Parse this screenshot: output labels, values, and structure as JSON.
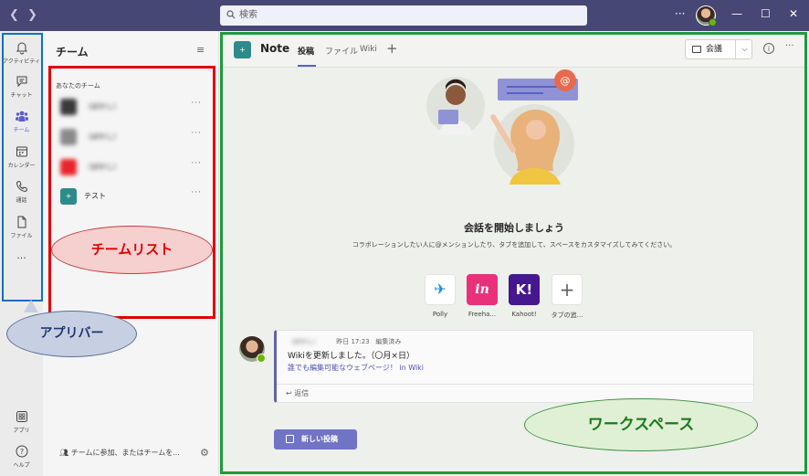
{
  "titlebar": {
    "search_placeholder": "検索",
    "more": "···",
    "minimize": "—",
    "maximize": "☐",
    "close": "✕"
  },
  "appbar": {
    "items": [
      {
        "label": "アクティビティ",
        "icon": "bell-icon"
      },
      {
        "label": "チャット",
        "icon": "chat-icon"
      },
      {
        "label": "チーム",
        "icon": "teams-icon",
        "active": true
      },
      {
        "label": "カレンダー",
        "icon": "calendar-icon"
      },
      {
        "label": "通話",
        "icon": "phone-icon"
      },
      {
        "label": "ファイル",
        "icon": "file-icon"
      }
    ],
    "more": "···",
    "bottom_items": [
      {
        "label": "アプリ",
        "icon": "apps-icon"
      },
      {
        "label": "ヘルプ",
        "icon": "help-icon"
      }
    ]
  },
  "team_pane": {
    "title": "チーム",
    "section_label": "あなたのチーム",
    "teams": [
      {
        "name": "（ぼかし）",
        "blurred": true,
        "logo_color": "#3a3a3a"
      },
      {
        "name": "（ぼかし）",
        "blurred": true,
        "logo_color": "#8a8a8a"
      },
      {
        "name": "（ぼかし）",
        "blurred": true,
        "logo_color": "#e8242c"
      },
      {
        "name": "テスト",
        "blurred": false,
        "logo_color": "#2e8b8b"
      }
    ],
    "more": "···",
    "join_label": "チームに参加、またはチームを..."
  },
  "callouts": {
    "team_list": "チームリスト",
    "app_bar": "アプリバー",
    "workspace": "ワークスペース"
  },
  "workspace": {
    "channel_name": "Note",
    "tabs": [
      "投稿",
      "ファイル",
      "Wiki"
    ],
    "tab_add": "+",
    "meet_label": "会議",
    "meet_caret": "⌵",
    "info": "i",
    "more": "···",
    "start_title": "会話を開始しましょう",
    "start_desc": "コラボレーションしたい人に@メンションしたり、タブを追加して、スペースをカスタマイズしてみてください。",
    "apps": [
      {
        "label": "Polly",
        "bg": "#ffffff",
        "glyph": "✈"
      },
      {
        "label": "Freeha...",
        "bg": "#e8317a",
        "glyph": "in"
      },
      {
        "label": "Kahoot!",
        "bg": "#46178f",
        "glyph": "K!"
      },
      {
        "label": "タブの追...",
        "bg": "#ffffff",
        "glyph": "+"
      }
    ],
    "post": {
      "author": "（ぼかし）",
      "time": "昨日 17:23",
      "status": "編集済み",
      "body1": "Wikiを更新しました。（〇月×日）",
      "body2": "誰でも編集可能なウェブページ！ in Wiki",
      "reply": "返信"
    },
    "new_post": "新しい投稿"
  },
  "colors": {
    "titlebar": "#464775",
    "accent": "#5b5fc7",
    "appbar_outline": "#0f6fc6",
    "teamlist_outline": "#e00000",
    "workspace_outline": "#1f9a3e"
  }
}
